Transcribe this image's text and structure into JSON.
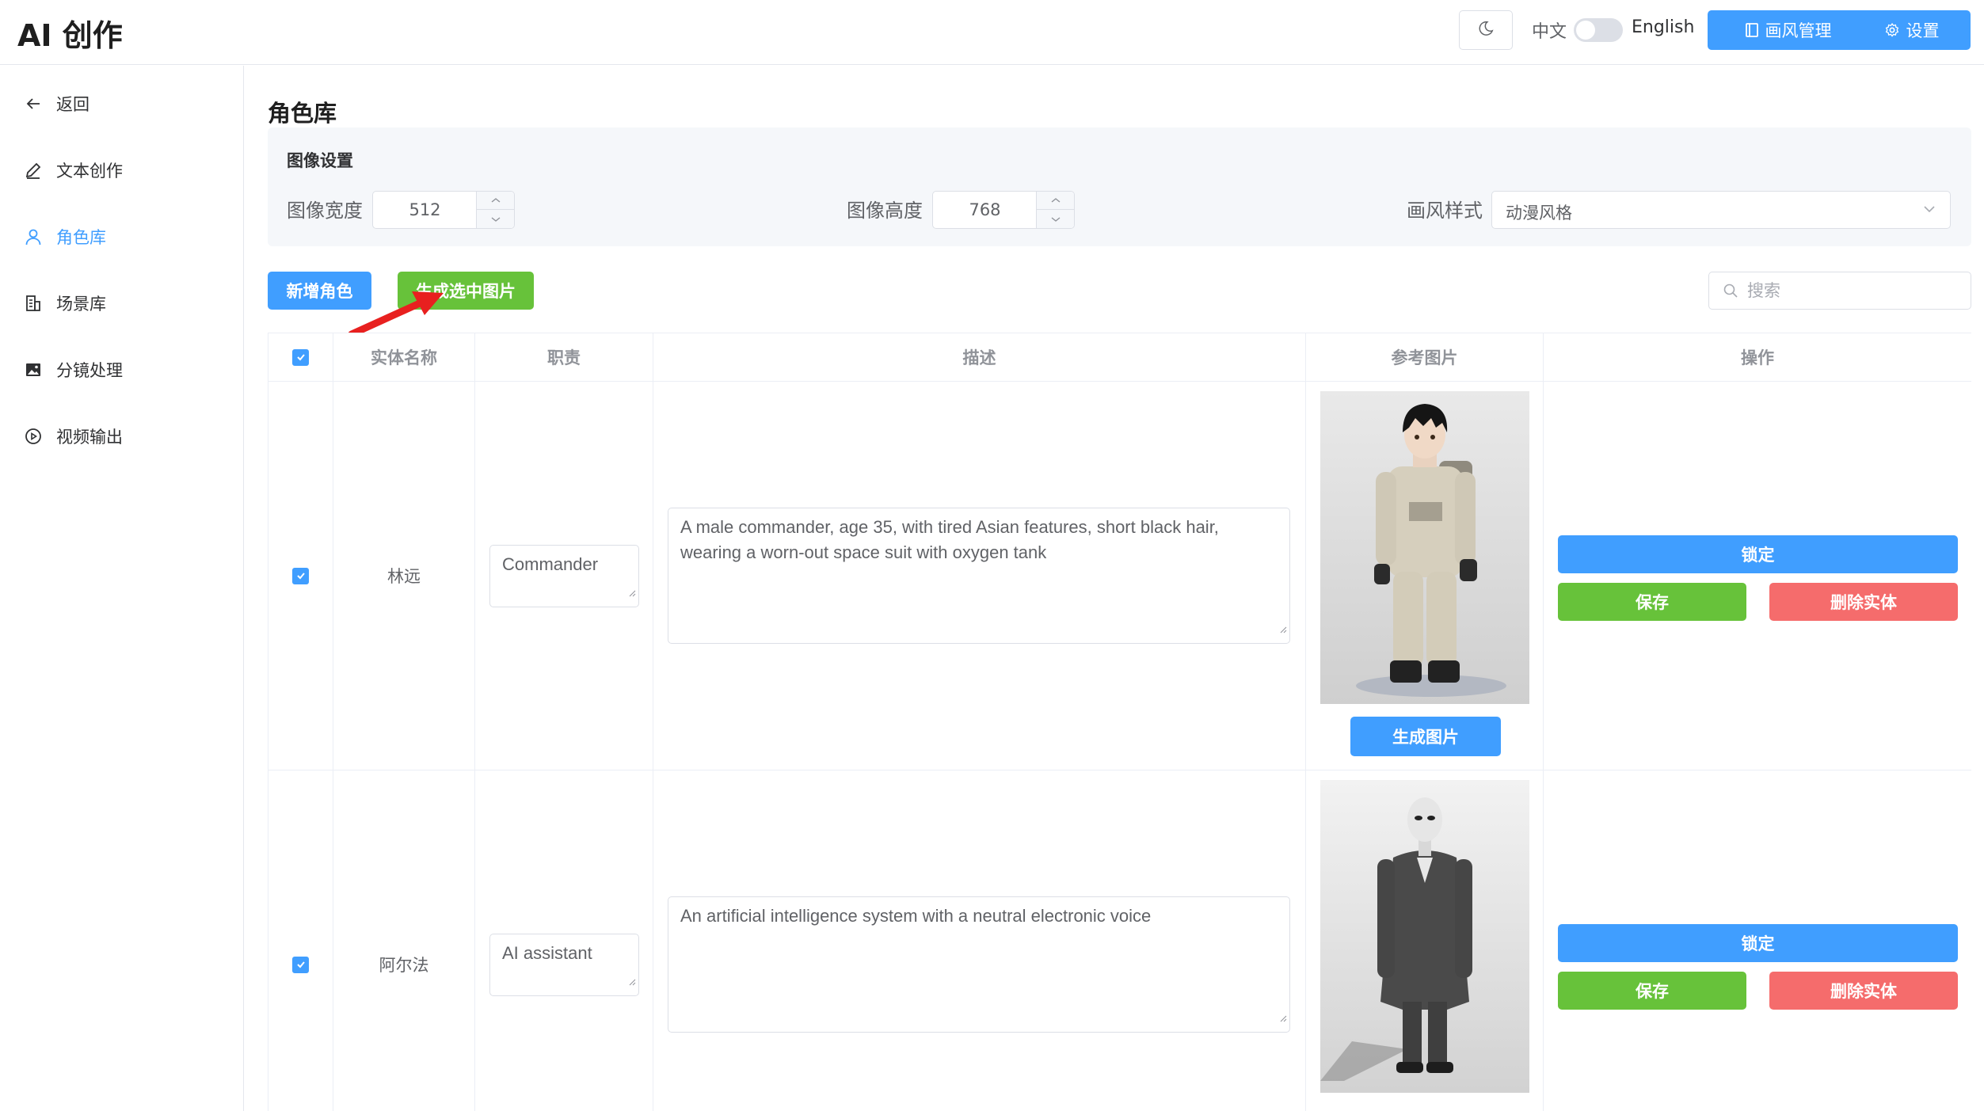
{
  "app": {
    "title": "AI 创作"
  },
  "header": {
    "lang_zh": "中文",
    "lang_en": "English",
    "style_mgr_label": "画风管理",
    "settings_label": "设置"
  },
  "sidebar": {
    "items": [
      {
        "label": "返回",
        "icon": "arrow-left-icon"
      },
      {
        "label": "文本创作",
        "icon": "pen-icon"
      },
      {
        "label": "角色库",
        "icon": "user-icon",
        "active": true
      },
      {
        "label": "场景库",
        "icon": "building-icon"
      },
      {
        "label": "分镜处理",
        "icon": "picture-icon"
      },
      {
        "label": "视频输出",
        "icon": "play-circle-icon"
      }
    ]
  },
  "main": {
    "page_title": "角色库",
    "image_settings": {
      "title": "图像设置",
      "width_label": "图像宽度",
      "width_value": "512",
      "height_label": "图像高度",
      "height_value": "768",
      "style_label": "画风样式",
      "style_value": "动漫风格"
    },
    "toolbar": {
      "add_label": "新增角色",
      "generate_selected_label": "生成选中图片",
      "search_placeholder": "搜索"
    },
    "table": {
      "columns": [
        "实体名称",
        "职责",
        "描述",
        "参考图片",
        "操作"
      ],
      "rows": [
        {
          "checked": true,
          "name": "林远",
          "role": "Commander",
          "description": "A male commander, age 35, with tired Asian features, short black hair, wearing a worn-out space suit with oxygen tank",
          "generate_label": "生成图片",
          "lock_label": "锁定",
          "save_label": "保存",
          "delete_label": "删除实体"
        },
        {
          "checked": true,
          "name": "阿尔法",
          "role": "AI assistant",
          "description": "An artificial intelligence system with a neutral electronic voice",
          "lock_label": "锁定",
          "save_label": "保存",
          "delete_label": "删除实体"
        }
      ]
    }
  },
  "colors": {
    "primary": "#409eff",
    "success": "#67c23a",
    "danger": "#f56c6c",
    "annotation_arrow": "#e8201f"
  }
}
